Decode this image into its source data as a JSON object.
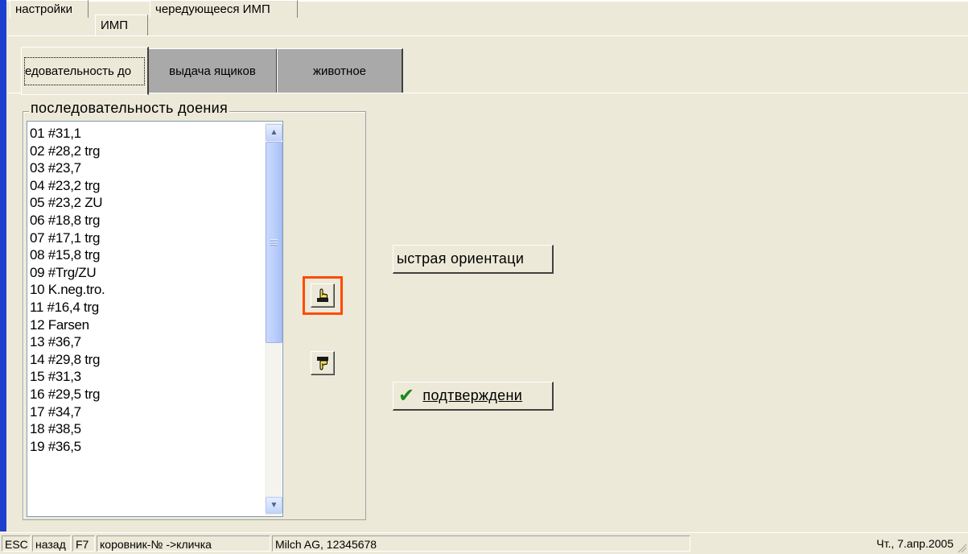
{
  "tabs_top": [
    {
      "label": "настройки",
      "active": false
    },
    {
      "label": "ИМП",
      "active": true
    },
    {
      "label": "чередующееся ИМП",
      "active": false
    }
  ],
  "tabs_sub": [
    {
      "label": "едовательность до",
      "active": true
    },
    {
      "label": "выдача ящиков",
      "active": false
    },
    {
      "label": "животное",
      "active": false
    }
  ],
  "group_title": "последовательность доения",
  "milking_order": [
    "01 #31,1",
    "02 #28,2 trg",
    "03 #23,7",
    "04 #23,2 trg",
    "05 #23,2 ZU",
    "06 #18,8 trg",
    "07 #17,1 trg",
    "08 #15,8 trg",
    "09 #Trg/ZU",
    "10 K.neg.tro.",
    "11 #16,4 trg",
    "12 Farsen",
    "13 #36,7",
    "14 #29,8 trg",
    "15 #31,3",
    "16 #29,5 trg",
    "17 #34,7",
    "18 #38,5",
    "19 #36,5"
  ],
  "buttons": {
    "move_up_icon": "hand-up-icon",
    "move_down_icon": "hand-down-icon",
    "quick_orientation": "ыстрая ориентаци",
    "confirm": "подтверждени"
  },
  "statusbar": {
    "esc": "ESC",
    "back": "назад",
    "f7": "F7",
    "cowshed_hint": "коровник-№ ->кличка",
    "company": "Milch AG, 12345678",
    "date": "Чт., 7.апр.2005"
  },
  "colors": {
    "window_bg": "#ece9d8",
    "highlight": "#ff4b00",
    "left_bar": "#1d3fcf"
  }
}
